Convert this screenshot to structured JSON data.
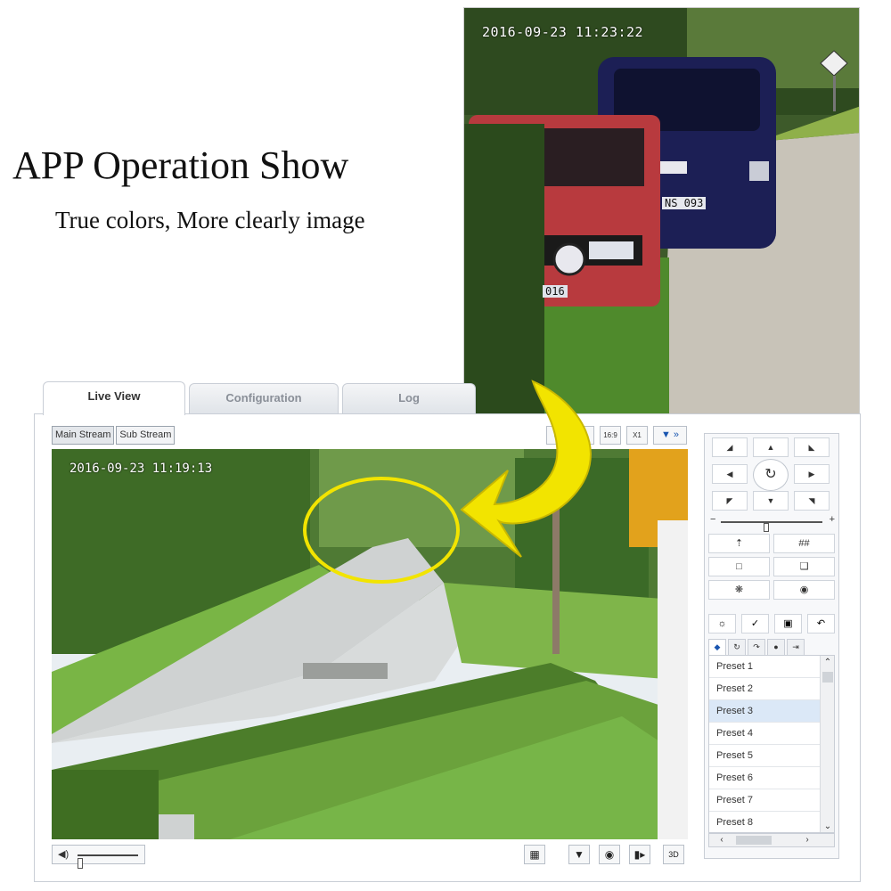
{
  "headline": "APP Operation Show",
  "subline": "True colors, More clearly image",
  "zoom_photo": {
    "timestamp": "2016-09-23 11:23:22",
    "plate_right": "NS 093",
    "plate_left": "016"
  },
  "tabs": [
    {
      "label": "Live View",
      "active": true
    },
    {
      "label": "Configuration",
      "active": false
    },
    {
      "label": "Log",
      "active": false
    }
  ],
  "streams": {
    "main": "Main Stream",
    "sub": "Sub Stream"
  },
  "top_tools": {
    "aspect": "16:9",
    "scale": "X1",
    "more": "»"
  },
  "video": {
    "timestamp": "2016-09-23 11:19:13"
  },
  "volume_level": 0.05,
  "bottom_tools": {
    "mic": "mic-icon",
    "snapshot": "camera-icon",
    "record": "video-record-icon",
    "three_d": "3D"
  },
  "ptz": {
    "speed_level": 0.45,
    "presets": [
      "Preset 1",
      "Preset 2",
      "Preset 3",
      "Preset 4",
      "Preset 5",
      "Preset 6",
      "Preset 7",
      "Preset 8"
    ],
    "selected_preset": "Preset 3"
  },
  "colors": {
    "callout": "#f2e400",
    "accent": "#1a56b0"
  }
}
